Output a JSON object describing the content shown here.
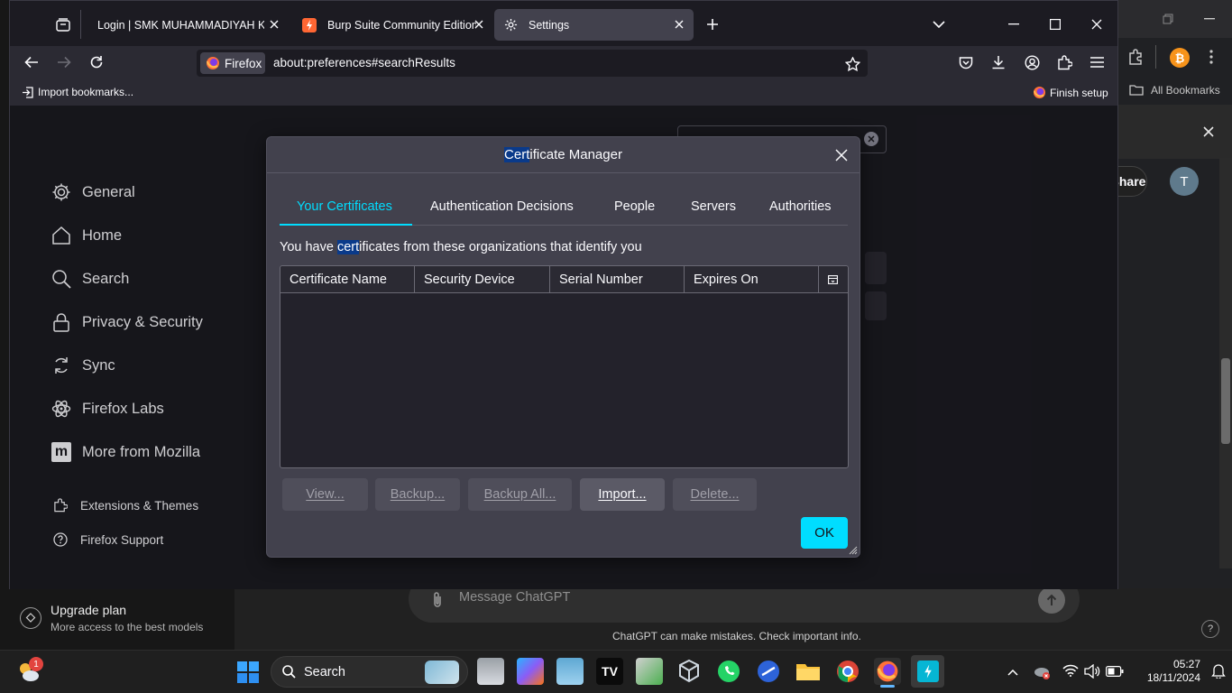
{
  "browser": {
    "tabs": [
      {
        "title": "Login | SMK MUHAMMADIYAH KUDUS"
      },
      {
        "title": "Burp Suite Community Edition"
      },
      {
        "title": "Settings"
      }
    ],
    "url_badge": "Firefox",
    "url": "about:preferences#searchResults",
    "bookmarks": {
      "import": "Import bookmarks...",
      "finish_setup": "Finish setup"
    }
  },
  "settings_nav": {
    "categories": [
      "General",
      "Home",
      "Search",
      "Privacy & Security",
      "Sync",
      "Firefox Labs",
      "More from Mozilla"
    ],
    "footer": [
      "Extensions & Themes",
      "Firefox Support"
    ]
  },
  "cert_manager": {
    "title_highlight": "Cert",
    "title_rest": "ificate Manager",
    "tabs": [
      "Your Certificates",
      "Authentication Decisions",
      "People",
      "Servers",
      "Authorities"
    ],
    "desc_pre": "You have ",
    "desc_highlight": "cert",
    "desc_post": "ificates from these organizations that identify you",
    "columns": [
      "Certificate Name",
      "Security Device",
      "Serial Number",
      "Expires On"
    ],
    "buttons": {
      "view": "View...",
      "backup": "Backup...",
      "backup_all": "Backup All...",
      "import": "Import...",
      "delete": "Delete...",
      "ok": "OK"
    }
  },
  "background_app": {
    "bookmarks": "All Bookmarks",
    "share": "Share",
    "avatar": "T",
    "upgrade_title": "Upgrade plan",
    "upgrade_sub": "More access to the best models",
    "message_placeholder": "Message ChatGPT",
    "disclaimer": "ChatGPT can make mistakes. Check important info.",
    "help": "?"
  },
  "taskbar": {
    "search": "Search",
    "time": "05:27",
    "date": "18/11/2024",
    "weather_badge": "1"
  },
  "colors": {
    "accent": "#00ddff",
    "dialog_bg": "#42414d",
    "content_bg": "#1c1b22",
    "highlight": "#0a3a8a"
  }
}
